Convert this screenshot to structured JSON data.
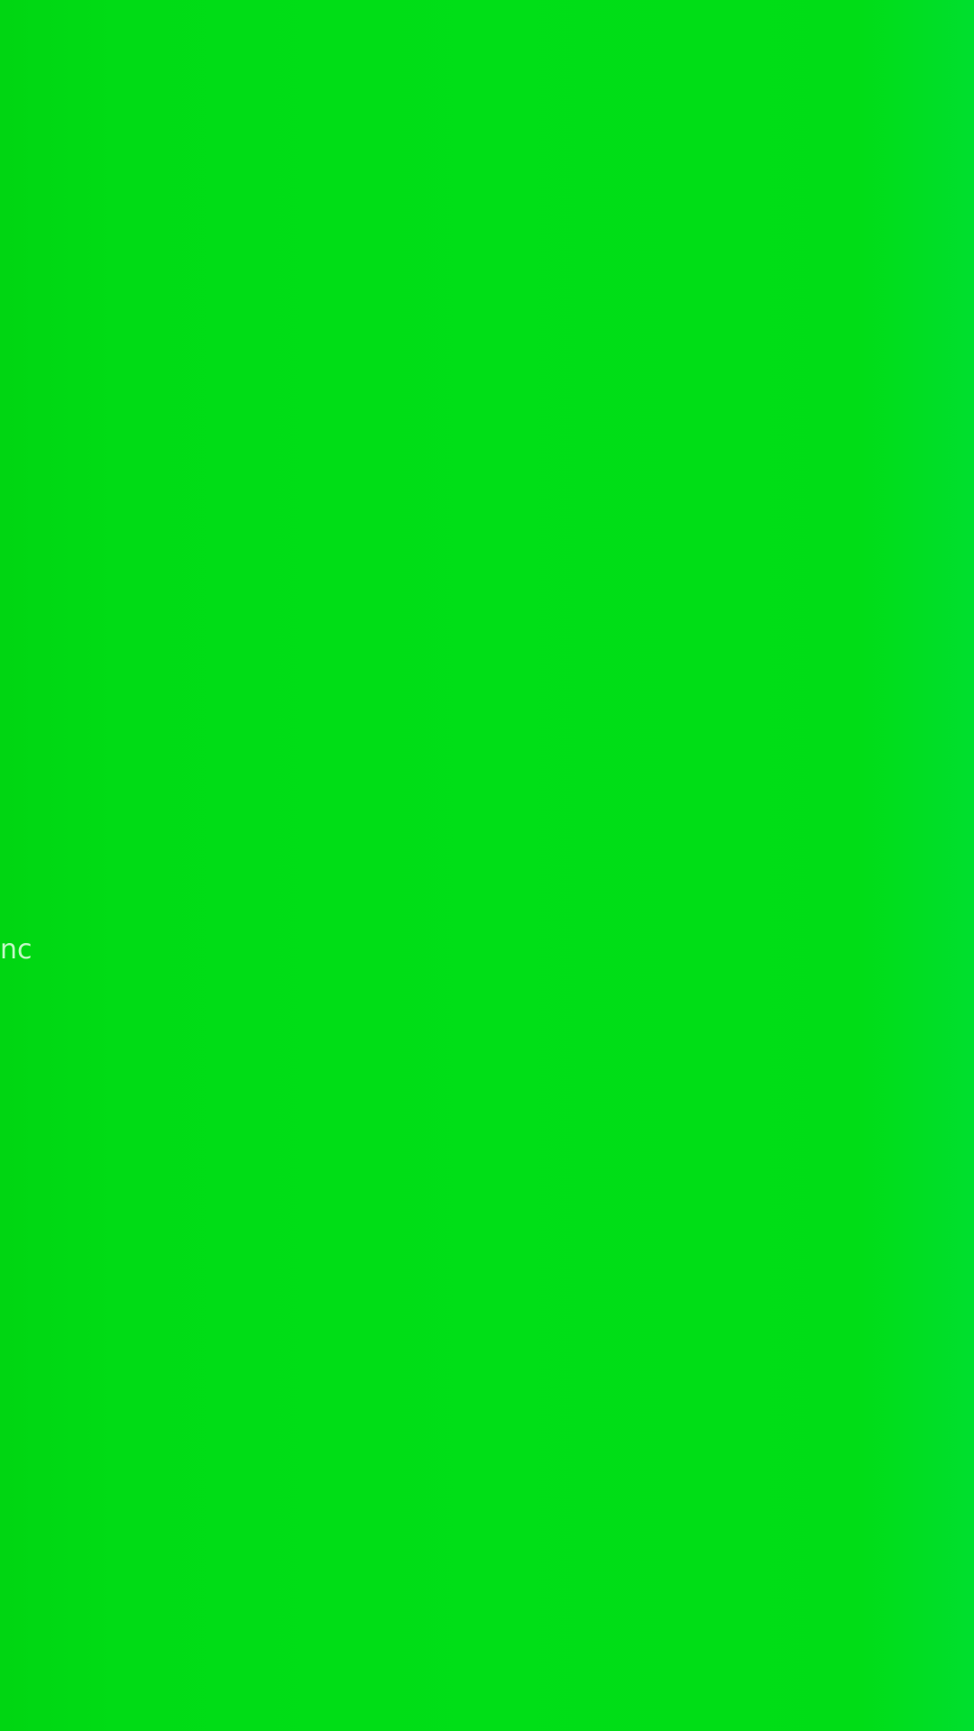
{
  "screen": {
    "background_color": "#00dd15",
    "fragment_text": "nc",
    "fragment_text_color": "#ebffeb"
  }
}
